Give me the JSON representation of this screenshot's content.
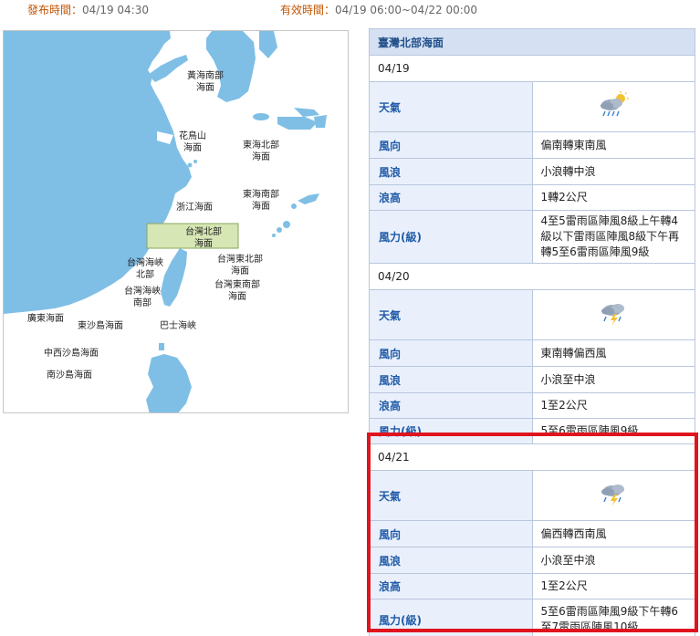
{
  "header": {
    "publish_label": "發布時間：",
    "publish_value": "04/19 04:30",
    "valid_label": "有效時間：",
    "valid_value": "04/19 06:00~04/22 00:00"
  },
  "map": {
    "regions": [
      {
        "l1": "黃海南部",
        "l2": "海面"
      },
      {
        "l1": "花鳥山",
        "l2": "海面"
      },
      {
        "l1": "東海北部",
        "l2": "海面"
      },
      {
        "l1": "浙江海面",
        "l2": ""
      },
      {
        "l1": "東海南部",
        "l2": "海面"
      },
      {
        "l1": "台灣北部",
        "l2": "海面"
      },
      {
        "l1": "台灣海峽",
        "l2": "北部"
      },
      {
        "l1": "台灣東北部",
        "l2": "海面"
      },
      {
        "l1": "台灣海峽",
        "l2": "南部"
      },
      {
        "l1": "台灣東南部",
        "l2": "海面"
      },
      {
        "l1": "廣東海面",
        "l2": ""
      },
      {
        "l1": "東沙島海面",
        "l2": ""
      },
      {
        "l1": "巴士海峽",
        "l2": ""
      },
      {
        "l1": "中西沙島海面",
        "l2": ""
      },
      {
        "l1": "南沙島海面",
        "l2": ""
      }
    ],
    "highlight_color": "#d6e6b4",
    "sea_color": "#ffffff",
    "land_color": "#7fbfe6"
  },
  "forecast": {
    "region": "臺灣北部海面",
    "labels": {
      "weather": "天氣",
      "wind_dir": "風向",
      "wave": "風浪",
      "wave_height": "浪高",
      "wind_force": "風力(級)"
    },
    "days": [
      {
        "date": "04/19",
        "weather_icon": "rain-cloud-sun-icon",
        "wind_dir": "偏南轉東南風",
        "wave": "小浪轉中浪",
        "wave_height": "1轉2公尺",
        "wind_force": "4至5雷雨區陣風8級上午轉4級以下雷雨區陣風8級下午再轉5至6雷雨區陣風9級"
      },
      {
        "date": "04/20",
        "weather_icon": "thunderstorm-icon",
        "wind_dir": "東南轉偏西風",
        "wave": "小浪至中浪",
        "wave_height": "1至2公尺",
        "wind_force": "5至6雷雨區陣風9級"
      },
      {
        "date": "04/21",
        "weather_icon": "thunderstorm-icon",
        "wind_dir": "偏西轉西南風",
        "wave": "小浪至中浪",
        "wave_height": "1至2公尺",
        "wind_force": "5至6雷雨區陣風9級下午轉6至7雷雨區陣風10級"
      }
    ],
    "highlight_border_color": "#e0141e"
  }
}
